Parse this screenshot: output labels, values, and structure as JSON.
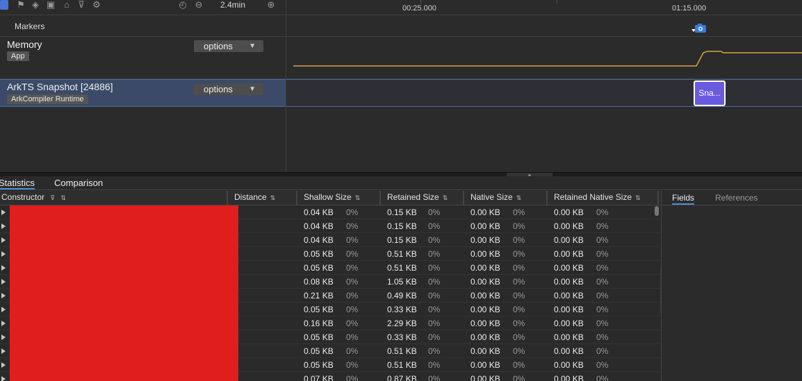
{
  "toolbar": {
    "icons": [
      "select-icon",
      "flag-icon",
      "target-icon",
      "camera-icon",
      "bank-icon",
      "filter-icon",
      "gear-icon"
    ],
    "duration": "2.4min"
  },
  "timeline": {
    "ruler_labels": [
      "00:25.000",
      "01:15.000"
    ],
    "markers_label": "Markers",
    "snapshot_chip": "Sna..."
  },
  "rows": {
    "memory": {
      "title": "Memory",
      "badge": "App",
      "options": "options"
    },
    "ark": {
      "title": "ArkTS Snapshot [24886]",
      "badge": "ArkCompiler Runtime",
      "options": "options"
    }
  },
  "tabs": [
    "Statistics",
    "Comparison"
  ],
  "columns": [
    "Constructor",
    "Distance",
    "Shallow Size",
    "Retained Size",
    "Native Size",
    "Retained Native Size"
  ],
  "rows_data": [
    {
      "shallow": "0.04 KB",
      "shallow_pct": "0%",
      "retained": "0.15 KB",
      "retained_pct": "0%",
      "native": "0.00 KB",
      "native_pct": "0%",
      "rnative": "0.00 KB",
      "rnative_pct": "0%"
    },
    {
      "shallow": "0.04 KB",
      "shallow_pct": "0%",
      "retained": "0.15 KB",
      "retained_pct": "0%",
      "native": "0.00 KB",
      "native_pct": "0%",
      "rnative": "0.00 KB",
      "rnative_pct": "0%"
    },
    {
      "shallow": "0.04 KB",
      "shallow_pct": "0%",
      "retained": "0.15 KB",
      "retained_pct": "0%",
      "native": "0.00 KB",
      "native_pct": "0%",
      "rnative": "0.00 KB",
      "rnative_pct": "0%"
    },
    {
      "shallow": "0.05 KB",
      "shallow_pct": "0%",
      "retained": "0.51 KB",
      "retained_pct": "0%",
      "native": "0.00 KB",
      "native_pct": "0%",
      "rnative": "0.00 KB",
      "rnative_pct": "0%"
    },
    {
      "shallow": "0.05 KB",
      "shallow_pct": "0%",
      "retained": "0.51 KB",
      "retained_pct": "0%",
      "native": "0.00 KB",
      "native_pct": "0%",
      "rnative": "0.00 KB",
      "rnative_pct": "0%"
    },
    {
      "shallow": "0.08 KB",
      "shallow_pct": "0%",
      "retained": "1.05 KB",
      "retained_pct": "0%",
      "native": "0.00 KB",
      "native_pct": "0%",
      "rnative": "0.00 KB",
      "rnative_pct": "0%"
    },
    {
      "shallow": "0.21 KB",
      "shallow_pct": "0%",
      "retained": "0.49 KB",
      "retained_pct": "0%",
      "native": "0.00 KB",
      "native_pct": "0%",
      "rnative": "0.00 KB",
      "rnative_pct": "0%"
    },
    {
      "shallow": "0.05 KB",
      "shallow_pct": "0%",
      "retained": "0.33 KB",
      "retained_pct": "0%",
      "native": "0.00 KB",
      "native_pct": "0%",
      "rnative": "0.00 KB",
      "rnative_pct": "0%"
    },
    {
      "shallow": "0.16 KB",
      "shallow_pct": "0%",
      "retained": "2.29 KB",
      "retained_pct": "0%",
      "native": "0.00 KB",
      "native_pct": "0%",
      "rnative": "0.00 KB",
      "rnative_pct": "0%"
    },
    {
      "shallow": "0.05 KB",
      "shallow_pct": "0%",
      "retained": "0.33 KB",
      "retained_pct": "0%",
      "native": "0.00 KB",
      "native_pct": "0%",
      "rnative": "0.00 KB",
      "rnative_pct": "0%"
    },
    {
      "shallow": "0.05 KB",
      "shallow_pct": "0%",
      "retained": "0.51 KB",
      "retained_pct": "0%",
      "native": "0.00 KB",
      "native_pct": "0%",
      "rnative": "0.00 KB",
      "rnative_pct": "0%"
    },
    {
      "shallow": "0.05 KB",
      "shallow_pct": "0%",
      "retained": "0.51 KB",
      "retained_pct": "0%",
      "native": "0.00 KB",
      "native_pct": "0%",
      "rnative": "0.00 KB",
      "rnative_pct": "0%"
    },
    {
      "shallow": "0.07 KB",
      "shallow_pct": "0%",
      "retained": "0.87 KB",
      "retained_pct": "0%",
      "native": "0.00 KB",
      "native_pct": "0%",
      "rnative": "0.00 KB",
      "rnative_pct": "0%"
    }
  ],
  "detail_tabs": [
    "Fields",
    "References"
  ],
  "colors": {
    "accent": "#4a90d9",
    "memory_line": "#d4a640",
    "snapshot": "#6a5ae0",
    "redaction": "#e01e1e"
  }
}
